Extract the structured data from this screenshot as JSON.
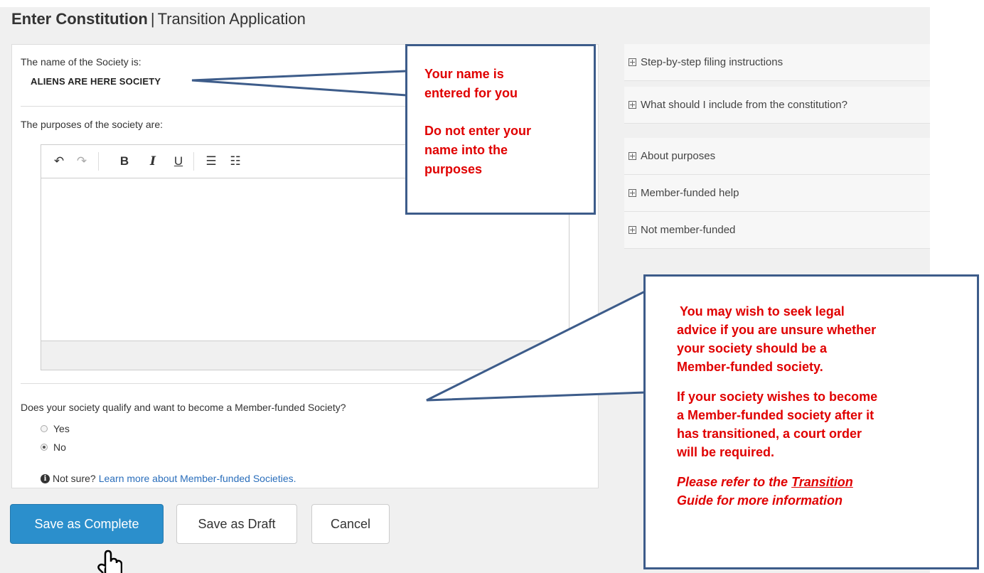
{
  "page": {
    "title_main": "Enter Constitution",
    "title_separator": "|",
    "title_sub": "Transition Application"
  },
  "form": {
    "name_label": "The name of the Society is:",
    "society_name": "ALIENS ARE HERE SOCIETY",
    "purposes_label": "The purposes of the society are:",
    "editor": {
      "toolbar": [
        {
          "name": "undo",
          "glyph": "↶"
        },
        {
          "name": "redo",
          "glyph": "↷"
        },
        {
          "name": "bold",
          "glyph": "B"
        },
        {
          "name": "italic",
          "glyph": "I"
        },
        {
          "name": "underline",
          "glyph": "U"
        },
        {
          "name": "ordered-list",
          "glyph": "☰"
        },
        {
          "name": "bullet-list",
          "glyph": "☷"
        }
      ],
      "value": ""
    },
    "member_funded_question": "Does your society qualify and want to become a Member-funded Society?",
    "options": [
      {
        "label": "Yes",
        "checked": false
      },
      {
        "label": "No",
        "checked": true
      }
    ],
    "info_text": "Not sure?",
    "info_link": "Learn more about Member-funded Societies."
  },
  "buttons": {
    "save_complete": "Save as Complete",
    "save_draft": "Save as Draft",
    "cancel": "Cancel"
  },
  "sidebar": {
    "items": [
      {
        "label": "Step-by-step filing instructions"
      },
      {
        "label": "What should I include from the constitution?"
      },
      {
        "label": "About purposes"
      },
      {
        "label": "Member-funded help"
      },
      {
        "label": "Not member-funded"
      }
    ]
  },
  "callouts": {
    "name": {
      "line1": "Your name is",
      "line2": "entered for you",
      "line3": "Do not enter your",
      "line4": "name into the",
      "line5": "purposes"
    },
    "member_funded": {
      "para1_l1": "You may wish to seek legal",
      "para1_l2": "advice if you are unsure whether",
      "para1_l3": "your society should be a",
      "para1_l4": "Member-funded society.",
      "para2_l1": "If your society wishes to become",
      "para2_l2": "a Member-funded society after it",
      "para2_l3": "has transitioned, a court order",
      "para2_l4": "will be required.",
      "para3_pre": "Please refer to the ",
      "para3_link": "Transition",
      "para3_post": "Guide for more information"
    }
  },
  "colors": {
    "primary_button": "#2b8fcc",
    "callout_text": "#e00000",
    "callout_border": "#3d5c8a",
    "link": "#2a6ebb"
  }
}
